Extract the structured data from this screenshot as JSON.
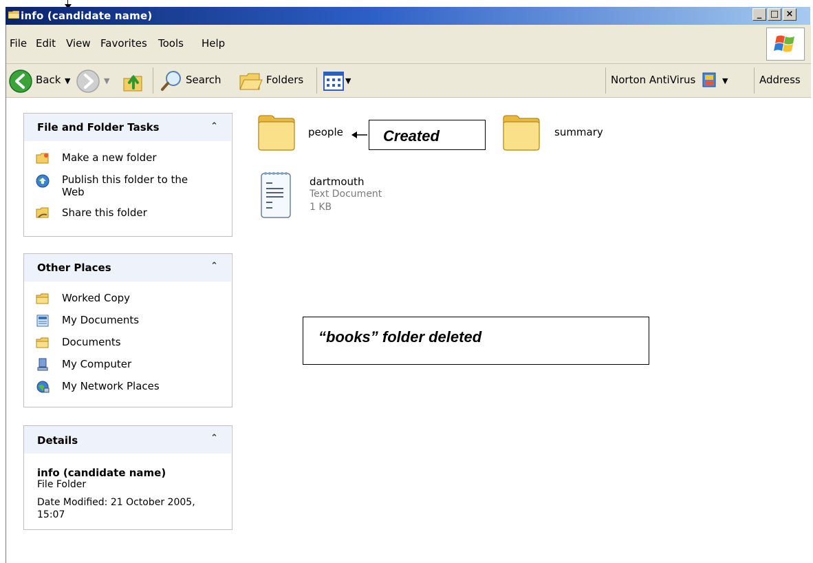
{
  "window": {
    "title": "info (candidate name)"
  },
  "menu": [
    {
      "label": "File"
    },
    {
      "label": "Edit"
    },
    {
      "label": "View"
    },
    {
      "label": "Favorites"
    },
    {
      "label": "Tools"
    },
    {
      "label": "Help"
    }
  ],
  "toolbar": {
    "back_label": "Back",
    "search_label": "Search",
    "folders_label": "Folders",
    "norton_label": "Norton AntiVirus",
    "address_label": "Address"
  },
  "panels": {
    "file_tasks": {
      "title": "File and Folder Tasks",
      "items": [
        {
          "label": "Make a new folder",
          "icon": "new-folder-icon"
        },
        {
          "label": "Publish this folder to the",
          "label2": "Web",
          "icon": "publish-web-icon"
        },
        {
          "label": "Share this folder",
          "icon": "share-folder-icon"
        }
      ]
    },
    "other_places": {
      "title": "Other Places",
      "items": [
        {
          "label": "Worked Copy",
          "icon": "folder-icon"
        },
        {
          "label": "My Documents",
          "icon": "my-documents-icon"
        },
        {
          "label": "Documents",
          "icon": "folder-icon"
        },
        {
          "label": "My Computer",
          "icon": "my-computer-icon"
        },
        {
          "label": "My Network Places",
          "icon": "network-places-icon"
        }
      ]
    },
    "details": {
      "title": "Details",
      "name": "info (candidate name)",
      "type": "File Folder",
      "modified_line1": "Date Modified: 21 October 2005,",
      "modified_line2": "15:07"
    }
  },
  "files": [
    {
      "name": "people",
      "kind": "folder"
    },
    {
      "name": "summary",
      "kind": "folder"
    },
    {
      "name": "dartmouth",
      "kind": "text",
      "type": "Text Document",
      "size": "1 KB"
    }
  ],
  "annotations": {
    "created": "Created",
    "deleted": "“books” folder deleted"
  },
  "colors": {
    "title_bar_start": "#0a246a",
    "title_bar_end": "#a6caf0",
    "toolbar_bg": "#ece9d8",
    "panel_head_bg": "#eef2fb",
    "folder_yellow": "#f6d36a"
  }
}
